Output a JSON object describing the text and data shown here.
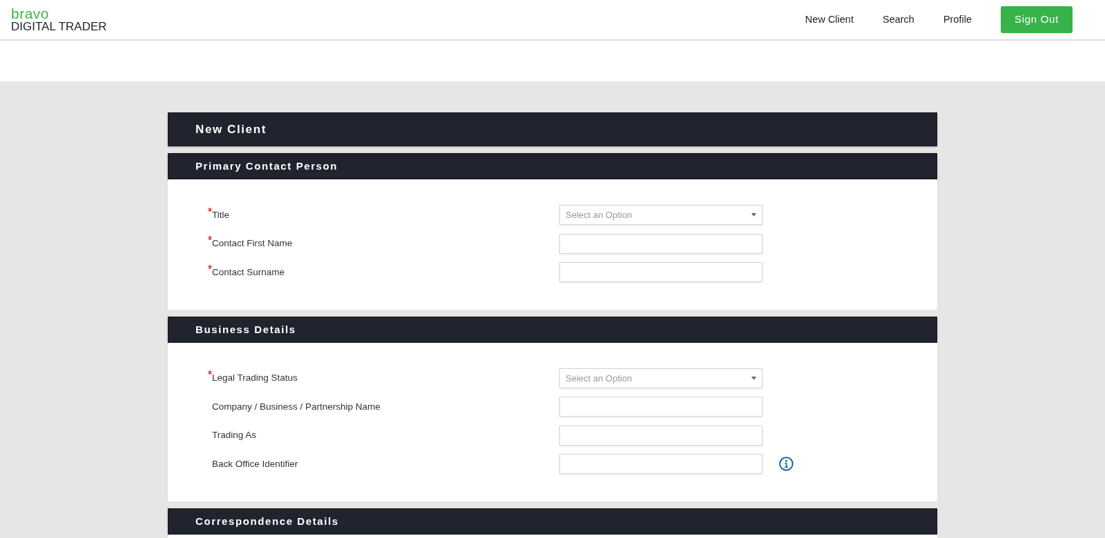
{
  "brand": {
    "name": "bravo",
    "tagline": "DIGITAL TRADER"
  },
  "nav": [
    {
      "label": "New Client",
      "kind": "link"
    },
    {
      "label": "Search",
      "kind": "link"
    },
    {
      "label": "Profile",
      "kind": "link"
    },
    {
      "label": "Sign Out",
      "kind": "button"
    }
  ],
  "page_title": "New Client",
  "sections": [
    {
      "title": "Primary Contact Person",
      "fields": [
        {
          "label": "Title",
          "kind": "select",
          "required": true,
          "placeholder": "Select an Option"
        },
        {
          "label": "Contact First Name",
          "kind": "text",
          "required": true
        },
        {
          "label": "Contact Surname",
          "kind": "text",
          "required": true
        }
      ]
    },
    {
      "title": "Business Details",
      "fields": [
        {
          "label": "Legal Trading Status",
          "kind": "select",
          "required": true,
          "placeholder": "Select an Option"
        },
        {
          "label": "Company / Business / Partnership Name",
          "kind": "text",
          "required": false
        },
        {
          "label": "Trading As",
          "kind": "text",
          "required": false
        },
        {
          "label": "Back Office Identifier",
          "kind": "text",
          "required": false,
          "info": true
        }
      ]
    },
    {
      "title": "Correspondence Details"
    }
  ]
}
